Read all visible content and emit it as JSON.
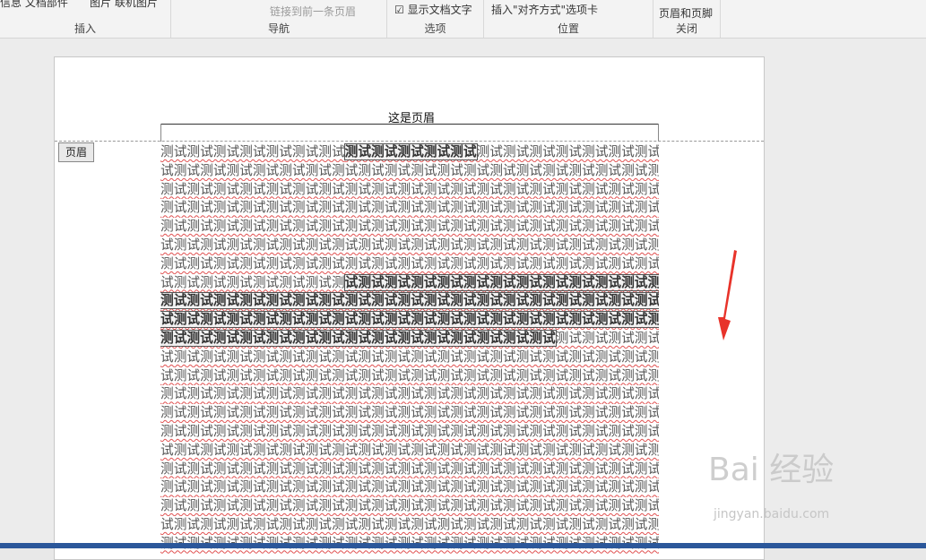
{
  "ribbon": {
    "top_left_labels": [
      "信息 文档部件",
      "图片 联机图片"
    ],
    "link_prev_header": "链接到前一条页眉",
    "show_doc_text": "显示文档文字",
    "insert_align_tab": "插入\"对齐方式\"选项卡",
    "close_header_footer": "页眉和页脚",
    "groups": {
      "insert": "插入",
      "nav": "导航",
      "options": "选项",
      "position": "位置",
      "close": "关闭"
    }
  },
  "header": {
    "text": "这是页眉",
    "tag": "页眉"
  },
  "body": {
    "lines": [
      [
        "测试测试测试测试测试测试测试",
        "测试测试测试测试测试",
        "测试测试测试测试测试测试测试测试测试测试测试测试测试"
      ],
      [
        "试测试测试测试测试测试测试测试测试测试测试测试测试测试测试测试测试测试测试测试测试测试测试测试",
        "",
        ""
      ],
      [
        "测试测试测试测试测试测试测试测试测试测试测试测试测试测试测试测试测试测试测试测试测试测试测试测试",
        "",
        ""
      ],
      [
        "测试测试测试测试测试测试测试测试测试测试测试测试测试测试测试测试测试测试测试测试测试测试测试测试",
        "",
        ""
      ],
      [
        "测试测试测试测试测试测试测试测试测试测试测试测试测试测试测试测试测试测试测试测试测试测试测试测",
        "",
        ""
      ],
      [
        "试测试测试测试测试测试测试测试测试测试测试测试测试测试测试测试测试测试测试测试测试测试测试测试",
        "",
        ""
      ],
      [
        "测试测试测试测试测试测试测试测试测试测试测试测试测试测试测试测试测试测试测试测试测试测试测试测试",
        "",
        ""
      ],
      [
        "试测试测试测试测试测试测试测",
        "试测试测试测试测试测试测试测试测试测试测试测试测试测试测试测试测试",
        ""
      ],
      [
        "",
        "测试测试测试测试测试测试测试测试测试测试测试测试测试测试测试测试测试测试测试测试测试测试测试测试",
        ""
      ],
      [
        "",
        "试测试测试测试测试测试测试测试测试测试测试测试测试测试测试测试测试测试测试测试测试测试测试测试",
        ""
      ],
      [
        "",
        "测试测试测试测试测试测试测试测试测试测试测试测试测试测试测试",
        "测试测试测试测试测试测试测试测试测试测试"
      ],
      [
        "试测试测试测试测试测试测试测试测试测试测试测试测试测试测试测试测试测试测试测试测试测试测试测试",
        "",
        ""
      ],
      [
        "试测试测试测试测试测试测试测试测试测试测试测试测试测试测试测试测试测试测试测试测试测试测试测",
        "",
        ""
      ],
      [
        "测试测试测试测试测试测试测试测试测试测试测试测试测试测试测试测试测试测试测试测试测试测试测试测试",
        "",
        ""
      ],
      [
        "测试测试测试测试测试测试测试测试测试测试测试测试测试测试测试测试测试测试测试测试测试测试测试测试",
        "",
        ""
      ],
      [
        "测试测试测试测试测试测试测试测试测试测试测试测试测试测试测试测试测试测试测试测试测试测试测试测",
        "",
        ""
      ],
      [
        "试测试测试测试测试测试测试测试测试测试测试测试测试测试测试测试测试测试测试测试测试测试测试测试",
        "",
        ""
      ],
      [
        "测试测试测试测试测试测试测试测试测试测试测试测试测试测试测试测试测试测试测试测试测试测试测试测试",
        "",
        ""
      ],
      [
        "测试测试测试测试测试测试测试测试测试测试测试测试测试测试测试测试测试测试测试测试测试测试测试测试",
        "",
        ""
      ],
      [
        "测试测试测试测试测试测试测试测试测试测试测试测试测试测试测试测试测试测试测试测试测试测试测试测试",
        "",
        ""
      ],
      [
        "试测试测试测试测试测试测试测试测试测试测试测试测试测试测试测试测试测试测试测试测试测试测试测试",
        "",
        ""
      ],
      [
        "测试测试测试测试测试测试测试测试测试测试测试测试测试测试测试测试测试测试测试测试测试测试测试测试",
        "",
        ""
      ]
    ]
  },
  "watermark": {
    "brand": "Bai 经验",
    "url": "jingyan.baidu.com"
  },
  "colors": {
    "status_bar": "#2b579a",
    "arrow": "#e8332a",
    "spell_underline": "#e05050"
  }
}
